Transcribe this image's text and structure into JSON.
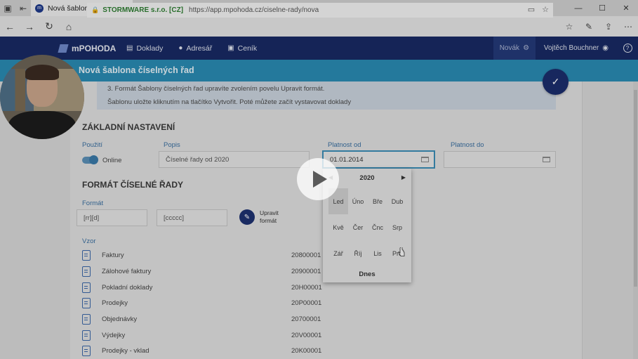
{
  "browser": {
    "tab_title": "Nová šablona číselných",
    "site_name": "STORMWARE s.r.o. [CZ]",
    "url": "https://app.mpohoda.cz/ciselne-rady/nova"
  },
  "app": {
    "brand": "mPOHODA",
    "menu": [
      {
        "label": "Doklady",
        "icon": "documents-icon"
      },
      {
        "label": "Adresář",
        "icon": "person-icon"
      },
      {
        "label": "Ceník",
        "icon": "price-list-icon"
      }
    ],
    "company": "Novák",
    "user": "Vojtěch Bouchner",
    "page_title": "Nová šablona číselných řad"
  },
  "info": {
    "line1": "3.  Formát Šablony číselných řad upravíte zvolením povelu Upravit formát.",
    "line2": "Šablonu uložte kliknutím na tlačítko Vytvořit. Poté můžete začít vystavovat doklady"
  },
  "basic": {
    "heading": "ZÁKLADNÍ NASTAVENÍ",
    "usage_label": "Použití",
    "usage_value": "Online",
    "desc_label": "Popis",
    "desc_value": "Číselné řady od 2020",
    "valid_from_label": "Platnost od",
    "valid_from_value": "01.01.2014",
    "valid_to_label": "Platnost do",
    "valid_to_value": ""
  },
  "format": {
    "heading": "FORMÁT ČÍSELNÉ ŘADY",
    "format_label": "Formát",
    "field1": "[rr][d]",
    "field2": "[ccccc]",
    "edit_line1": "Upravit",
    "edit_line2": "formát",
    "vzor_label": "Vzor",
    "rows": [
      {
        "name": "Faktury",
        "code": "20800001"
      },
      {
        "name": "Zálohové faktury",
        "code": "20900001"
      },
      {
        "name": "Pokladní doklady",
        "code": "20H00001"
      },
      {
        "name": "Prodejky",
        "code": "20P00001"
      },
      {
        "name": "Objednávky",
        "code": "20700001"
      },
      {
        "name": "Výdejky",
        "code": "20V00001"
      },
      {
        "name": "Prodejky - vklad",
        "code": "20K00001"
      }
    ]
  },
  "picker": {
    "year": "2020",
    "months": [
      "Led",
      "Úno",
      "Bře",
      "Dub",
      "Kvě",
      "Čer",
      "Čnc",
      "Srp",
      "Zář",
      "Říj",
      "Lis",
      "Pro"
    ],
    "today": "Dnes"
  }
}
